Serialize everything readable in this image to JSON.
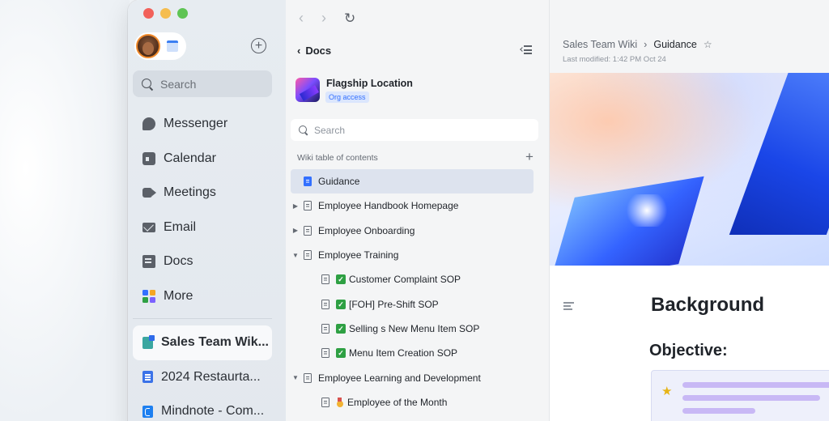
{
  "sidebar": {
    "search_placeholder": "Search",
    "nav": [
      {
        "label": "Messenger",
        "icon": "messenger-icon"
      },
      {
        "label": "Calendar",
        "icon": "calendar-icon"
      },
      {
        "label": "Meetings",
        "icon": "video-icon"
      },
      {
        "label": "Email",
        "icon": "mail-icon"
      },
      {
        "label": "Docs",
        "icon": "docs-icon"
      },
      {
        "label": "More",
        "icon": "grid-icon"
      }
    ],
    "recent": [
      {
        "label": "Sales Team Wik...",
        "icon": "wiki-icon"
      },
      {
        "label": "2024 Restaurta...",
        "icon": "doc-icon"
      },
      {
        "label": "Mindnote - Com...",
        "icon": "mindnote-icon"
      }
    ]
  },
  "middle": {
    "back_label": "Docs",
    "space_name": "Flagship Location",
    "space_badge": "Org access",
    "search_placeholder": "Search",
    "toc_heading": "Wiki table of contents",
    "tree": [
      {
        "label": "Guidance",
        "depth": 0,
        "caret": "",
        "active": true,
        "prefix": ""
      },
      {
        "label": "Employee Handbook Homepage",
        "depth": 0,
        "caret": "▶",
        "prefix": ""
      },
      {
        "label": "Employee Onboarding",
        "depth": 0,
        "caret": "▶",
        "prefix": ""
      },
      {
        "label": "Employee Training",
        "depth": 0,
        "caret": "▼",
        "prefix": ""
      },
      {
        "label": "Customer Complaint SOP",
        "depth": 1,
        "caret": "",
        "prefix": "check"
      },
      {
        "label": "[FOH] Pre-Shift SOP",
        "depth": 1,
        "caret": "",
        "prefix": "check"
      },
      {
        "label": "Selling s New Menu Item SOP",
        "depth": 1,
        "caret": "",
        "prefix": "check"
      },
      {
        "label": "Menu Item Creation SOP",
        "depth": 1,
        "caret": "",
        "prefix": "check"
      },
      {
        "label": "Employee Learning and Development",
        "depth": 0,
        "caret": "▼",
        "prefix": ""
      },
      {
        "label": "Employee of the Month",
        "depth": 1,
        "caret": "",
        "prefix": "medal"
      }
    ]
  },
  "right": {
    "breadcrumb_parent": "Sales Team Wiki",
    "breadcrumb_separator": "›",
    "breadcrumb_current": "Guidance",
    "last_modified": "Last modified: 1:42 PM Oct 24",
    "heading": "Background",
    "subheading": "Objective:"
  },
  "colors": {
    "accent": "#3370ff",
    "active_row": "#dde3ee",
    "check_green": "#2ea043"
  }
}
